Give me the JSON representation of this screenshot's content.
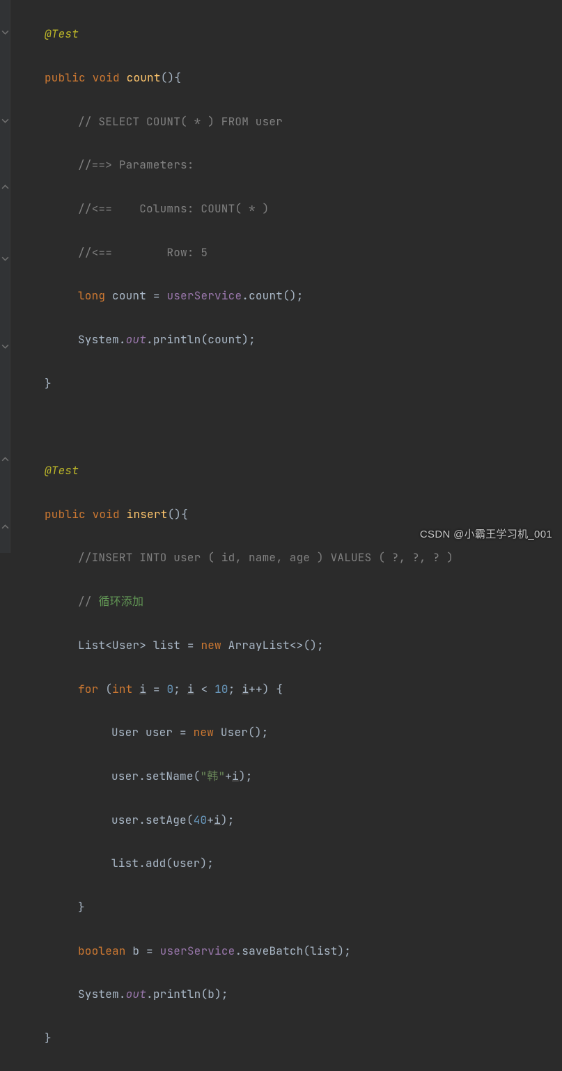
{
  "code": {
    "test_annotation": "@Test",
    "kw_public": "public",
    "kw_void": "void",
    "kw_long": "long",
    "kw_new": "new",
    "kw_for": "for",
    "kw_int": "int",
    "kw_boolean": "boolean",
    "method_count": "count",
    "method_insert": "insert",
    "comment_select": "// SELECT COUNT( * ) FROM user",
    "comment_params": "//==> Parameters:",
    "comment_columns": "//<==    Columns: COUNT( * )",
    "comment_row": "//<==        Row: 5",
    "comment_insert": "//INSERT INTO user ( id, name, age ) VALUES ( ?, ?, ? )",
    "comment_loop_prefix": "// ",
    "comment_loop_cn": "循环添加",
    "count_var": "count",
    "eq": " = ",
    "userService": "userService",
    "dot": ".",
    "count_call": "count",
    "lparen": "(",
    "rparen": ")",
    "lbrace": "{",
    "rbrace": "}",
    "semi": ";",
    "System": "System",
    "out": "out",
    "println": "println",
    "List": "List",
    "lt": "<",
    "gt": ">",
    "User": "User",
    "list": "list",
    "ArrayList": "ArrayList",
    "diamond": "<>",
    "i": "i",
    "zero": "0",
    "ten": "10",
    "forty": "40",
    "ltop": " < ",
    "pp": "++",
    "user_var": "user",
    "space": " ",
    "setName": "setName",
    "han_str": "\"韩\"",
    "plus": "+",
    "setAge": "setAge",
    "add": "add",
    "b": "b",
    "saveBatch": "saveBatch"
  },
  "watermark": "CSDN @小霸王学习机_001"
}
